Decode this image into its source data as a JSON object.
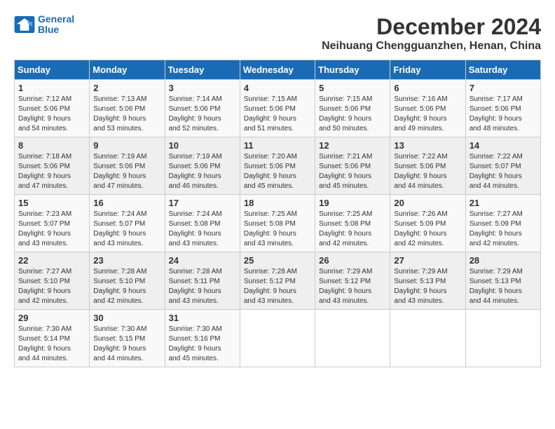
{
  "logo": {
    "line1": "General",
    "line2": "Blue"
  },
  "title": "December 2024",
  "subtitle": "Neihuang Chengguanzhen, Henan, China",
  "days_of_week": [
    "Sunday",
    "Monday",
    "Tuesday",
    "Wednesday",
    "Thursday",
    "Friday",
    "Saturday"
  ],
  "weeks": [
    [
      {
        "day": 1,
        "info": "Sunrise: 7:12 AM\nSunset: 5:06 PM\nDaylight: 9 hours\nand 54 minutes."
      },
      {
        "day": 2,
        "info": "Sunrise: 7:13 AM\nSunset: 5:06 PM\nDaylight: 9 hours\nand 53 minutes."
      },
      {
        "day": 3,
        "info": "Sunrise: 7:14 AM\nSunset: 5:06 PM\nDaylight: 9 hours\nand 52 minutes."
      },
      {
        "day": 4,
        "info": "Sunrise: 7:15 AM\nSunset: 5:06 PM\nDaylight: 9 hours\nand 51 minutes."
      },
      {
        "day": 5,
        "info": "Sunrise: 7:15 AM\nSunset: 5:06 PM\nDaylight: 9 hours\nand 50 minutes."
      },
      {
        "day": 6,
        "info": "Sunrise: 7:16 AM\nSunset: 5:06 PM\nDaylight: 9 hours\nand 49 minutes."
      },
      {
        "day": 7,
        "info": "Sunrise: 7:17 AM\nSunset: 5:06 PM\nDaylight: 9 hours\nand 48 minutes."
      }
    ],
    [
      {
        "day": 8,
        "info": "Sunrise: 7:18 AM\nSunset: 5:06 PM\nDaylight: 9 hours\nand 47 minutes."
      },
      {
        "day": 9,
        "info": "Sunrise: 7:19 AM\nSunset: 5:06 PM\nDaylight: 9 hours\nand 47 minutes."
      },
      {
        "day": 10,
        "info": "Sunrise: 7:19 AM\nSunset: 5:06 PM\nDaylight: 9 hours\nand 46 minutes."
      },
      {
        "day": 11,
        "info": "Sunrise: 7:20 AM\nSunset: 5:06 PM\nDaylight: 9 hours\nand 45 minutes."
      },
      {
        "day": 12,
        "info": "Sunrise: 7:21 AM\nSunset: 5:06 PM\nDaylight: 9 hours\nand 45 minutes."
      },
      {
        "day": 13,
        "info": "Sunrise: 7:22 AM\nSunset: 5:06 PM\nDaylight: 9 hours\nand 44 minutes."
      },
      {
        "day": 14,
        "info": "Sunrise: 7:22 AM\nSunset: 5:07 PM\nDaylight: 9 hours\nand 44 minutes."
      }
    ],
    [
      {
        "day": 15,
        "info": "Sunrise: 7:23 AM\nSunset: 5:07 PM\nDaylight: 9 hours\nand 43 minutes."
      },
      {
        "day": 16,
        "info": "Sunrise: 7:24 AM\nSunset: 5:07 PM\nDaylight: 9 hours\nand 43 minutes."
      },
      {
        "day": 17,
        "info": "Sunrise: 7:24 AM\nSunset: 5:08 PM\nDaylight: 9 hours\nand 43 minutes."
      },
      {
        "day": 18,
        "info": "Sunrise: 7:25 AM\nSunset: 5:08 PM\nDaylight: 9 hours\nand 43 minutes."
      },
      {
        "day": 19,
        "info": "Sunrise: 7:25 AM\nSunset: 5:08 PM\nDaylight: 9 hours\nand 42 minutes."
      },
      {
        "day": 20,
        "info": "Sunrise: 7:26 AM\nSunset: 5:09 PM\nDaylight: 9 hours\nand 42 minutes."
      },
      {
        "day": 21,
        "info": "Sunrise: 7:27 AM\nSunset: 5:09 PM\nDaylight: 9 hours\nand 42 minutes."
      }
    ],
    [
      {
        "day": 22,
        "info": "Sunrise: 7:27 AM\nSunset: 5:10 PM\nDaylight: 9 hours\nand 42 minutes."
      },
      {
        "day": 23,
        "info": "Sunrise: 7:28 AM\nSunset: 5:10 PM\nDaylight: 9 hours\nand 42 minutes."
      },
      {
        "day": 24,
        "info": "Sunrise: 7:28 AM\nSunset: 5:11 PM\nDaylight: 9 hours\nand 43 minutes."
      },
      {
        "day": 25,
        "info": "Sunrise: 7:28 AM\nSunset: 5:12 PM\nDaylight: 9 hours\nand 43 minutes."
      },
      {
        "day": 26,
        "info": "Sunrise: 7:29 AM\nSunset: 5:12 PM\nDaylight: 9 hours\nand 43 minutes."
      },
      {
        "day": 27,
        "info": "Sunrise: 7:29 AM\nSunset: 5:13 PM\nDaylight: 9 hours\nand 43 minutes."
      },
      {
        "day": 28,
        "info": "Sunrise: 7:29 AM\nSunset: 5:13 PM\nDaylight: 9 hours\nand 44 minutes."
      }
    ],
    [
      {
        "day": 29,
        "info": "Sunrise: 7:30 AM\nSunset: 5:14 PM\nDaylight: 9 hours\nand 44 minutes."
      },
      {
        "day": 30,
        "info": "Sunrise: 7:30 AM\nSunset: 5:15 PM\nDaylight: 9 hours\nand 44 minutes."
      },
      {
        "day": 31,
        "info": "Sunrise: 7:30 AM\nSunset: 5:16 PM\nDaylight: 9 hours\nand 45 minutes."
      },
      null,
      null,
      null,
      null
    ]
  ]
}
